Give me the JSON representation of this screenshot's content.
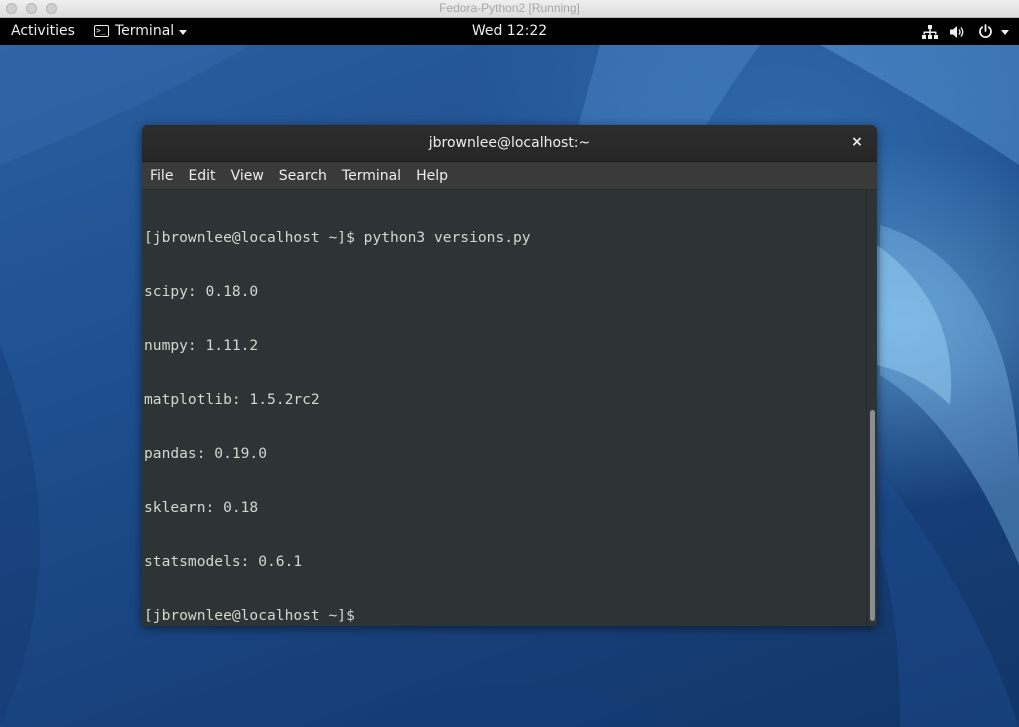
{
  "host_window": {
    "title": "Fedora-Python2 [Running]"
  },
  "topbar": {
    "activities_label": "Activities",
    "app_menu_label": "Terminal",
    "app_menu_icon": "terminal-icon",
    "clock": "Wed 12:22",
    "status_icons": [
      "network-icon",
      "volume-icon",
      "power-icon",
      "chevron-down-icon"
    ]
  },
  "terminal": {
    "title": "jbrownlee@localhost:~",
    "close_glyph": "×",
    "menu": [
      "File",
      "Edit",
      "View",
      "Search",
      "Terminal",
      "Help"
    ],
    "lines": [
      "[jbrownlee@localhost ~]$ python3 versions.py",
      "scipy: 0.18.0",
      "numpy: 1.11.2",
      "matplotlib: 1.5.2rc2",
      "pandas: 0.19.0",
      "sklearn: 0.18",
      "statsmodels: 0.6.1",
      "[jbrownlee@localhost ~]$ "
    ],
    "colors": {
      "background": "#2e3436",
      "foreground": "#d3d7cf"
    }
  }
}
